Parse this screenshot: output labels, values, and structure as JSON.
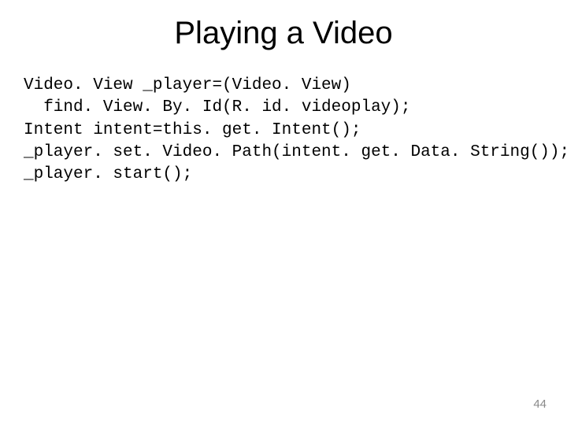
{
  "slide": {
    "title": "Playing a Video",
    "code_lines": {
      "l1": "Video. View _player=(Video. View)",
      "l2": "  find. View. By. Id(R. id. videoplay);",
      "l3": "Intent intent=this. get. Intent();",
      "l4": "_player. set. Video. Path(intent. get. Data. String());",
      "l5": "_player. start();"
    },
    "page_number": "44"
  }
}
